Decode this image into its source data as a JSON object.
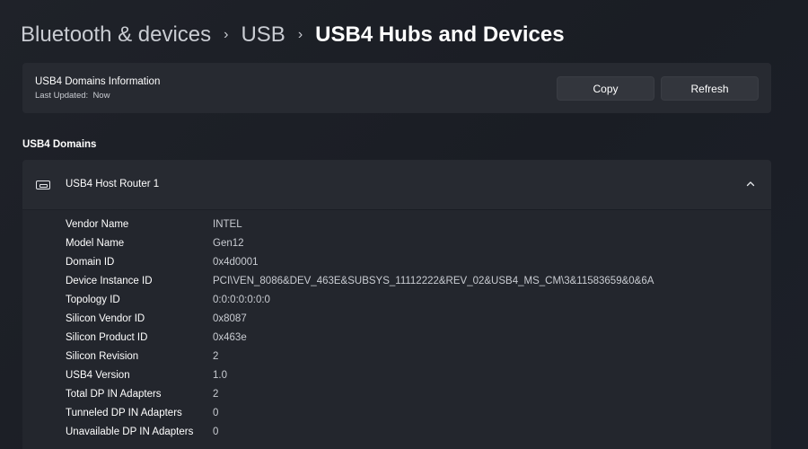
{
  "breadcrumb": {
    "items": [
      "Bluetooth & devices",
      "USB"
    ],
    "current": "USB4 Hubs and Devices"
  },
  "info_card": {
    "title": "USB4 Domains Information",
    "last_updated_label": "Last Updated:",
    "last_updated_value": "Now",
    "copy_label": "Copy",
    "refresh_label": "Refresh"
  },
  "domains": {
    "section_title": "USB4 Domains",
    "router": {
      "label": "USB4 Host Router 1",
      "icon": "usb-port-icon",
      "expanded_icon": "chevron-up-icon",
      "properties": [
        {
          "label": "Vendor Name",
          "value": "INTEL"
        },
        {
          "label": "Model Name",
          "value": "Gen12"
        },
        {
          "label": "Domain ID",
          "value": "0x4d0001"
        },
        {
          "label": "Device Instance ID",
          "value": "PCI\\VEN_8086&DEV_463E&SUBSYS_11112222&REV_02&USB4_MS_CM\\3&11583659&0&6A"
        },
        {
          "label": "Topology ID",
          "value": "0:0:0:0:0:0:0"
        },
        {
          "label": "Silicon Vendor ID",
          "value": "0x8087"
        },
        {
          "label": "Silicon Product ID",
          "value": "0x463e"
        },
        {
          "label": "Silicon Revision",
          "value": "2"
        },
        {
          "label": "USB4 Version",
          "value": "1.0"
        },
        {
          "label": "Total DP IN Adapters",
          "value": "2"
        },
        {
          "label": "Tunneled DP IN Adapters",
          "value": "0"
        },
        {
          "label": "Unavailable DP IN Adapters",
          "value": "0"
        }
      ]
    }
  },
  "colors": {
    "background": "#1c1f26",
    "card": "#272a31",
    "button": "#33363d",
    "secondary_text": "#c9ccd2"
  }
}
